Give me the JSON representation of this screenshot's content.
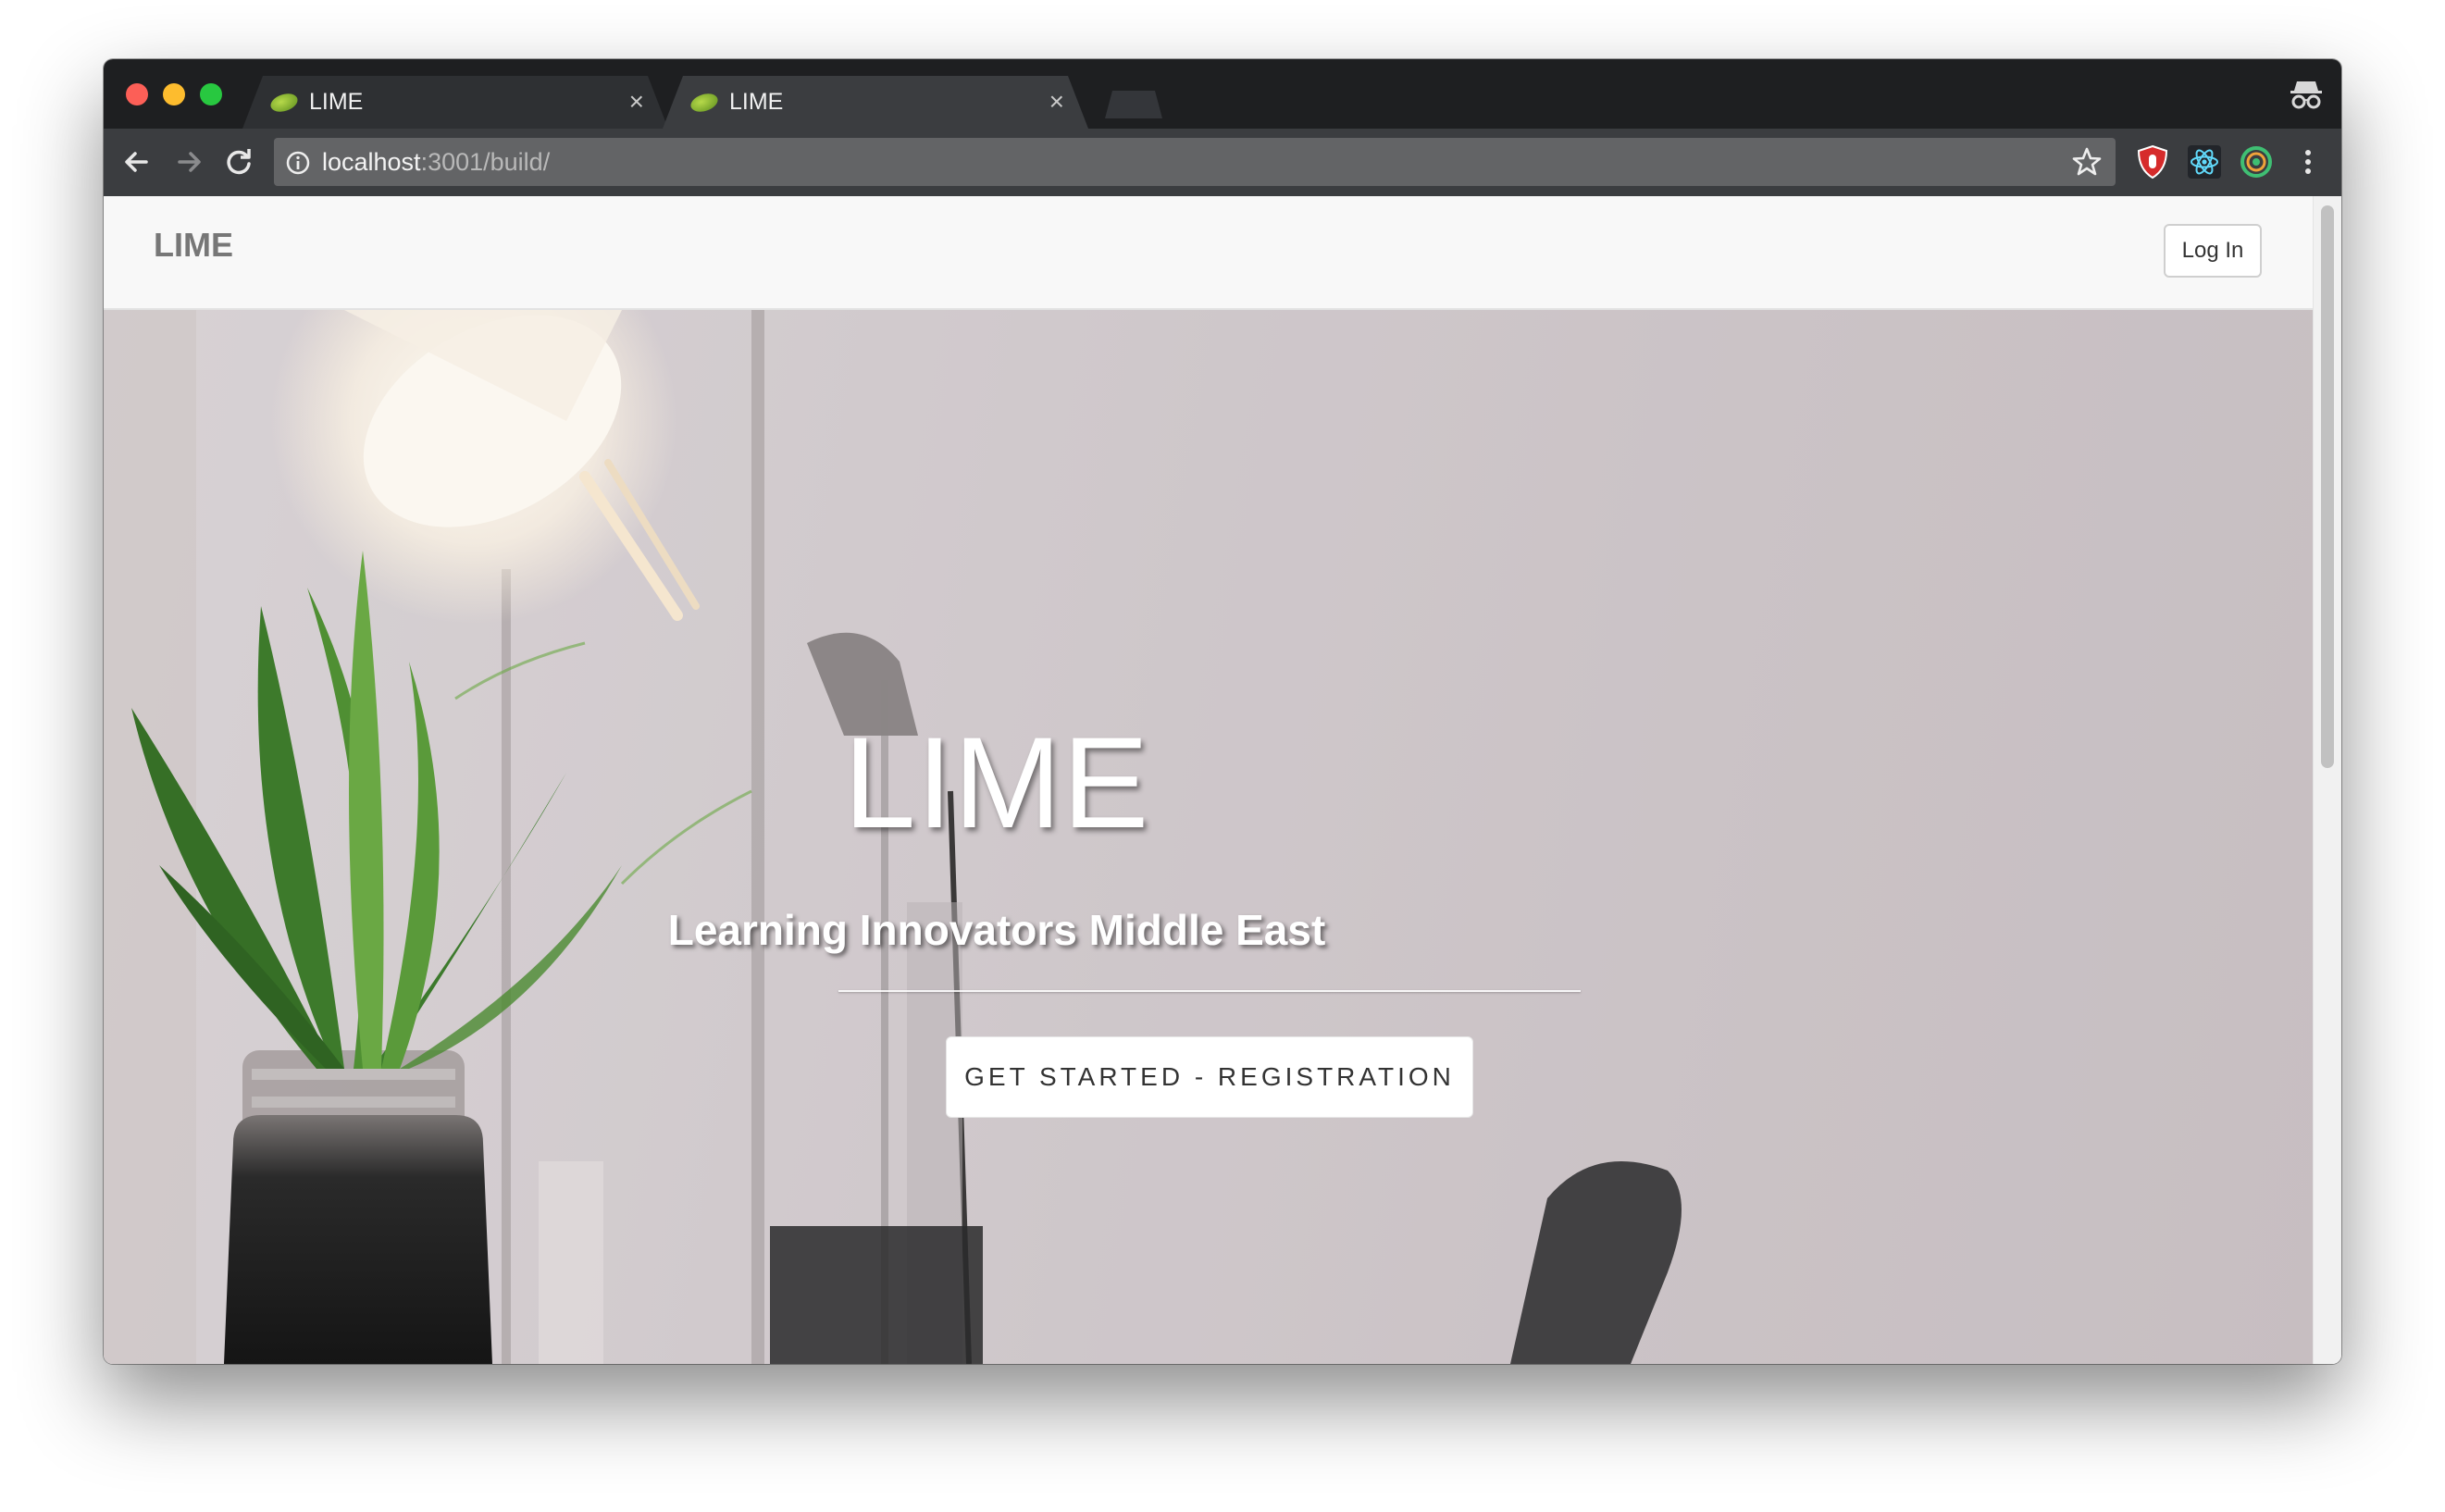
{
  "browser": {
    "tabs": [
      {
        "title": "LIME"
      },
      {
        "title": "LIME"
      }
    ],
    "tab_close_glyph": "×",
    "address": {
      "host": "localhost",
      "path": ":3001/build/"
    },
    "extensions": [
      "ublock-icon",
      "react-devtools-icon",
      "extension-ring-icon"
    ]
  },
  "page": {
    "navbar": {
      "brand": "LIME",
      "login_label": "Log In"
    },
    "hero": {
      "title": "LIME",
      "subtitle": "Learning Innovators Middle East",
      "cta_label": "GET STARTED - REGISTRATION"
    }
  },
  "colors": {
    "titlebar": "#1e1f21",
    "toolbar": "#3b3d40",
    "omnibox": "#636466",
    "navbar_bg": "#f8f8f8",
    "brand_text": "#777777",
    "hero_bg": "#cfc8cb"
  }
}
